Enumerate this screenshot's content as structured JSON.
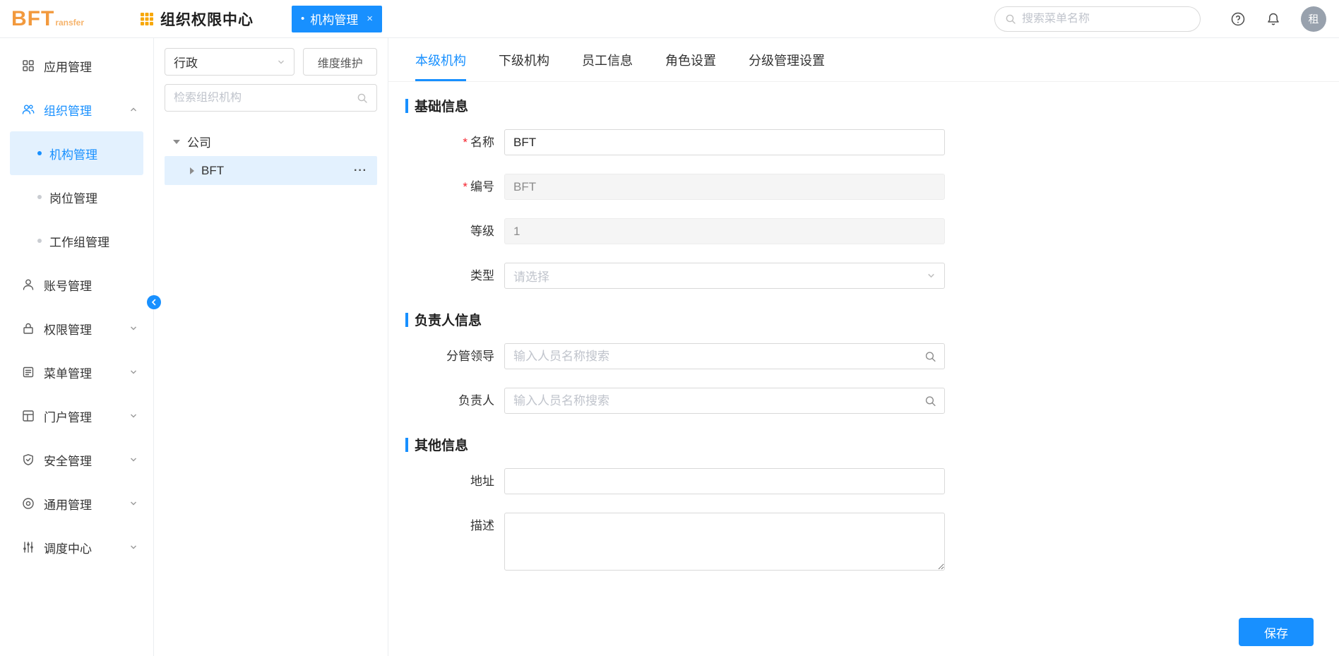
{
  "colors": {
    "primary": "#1890ff",
    "logo_orange": "#f2993d",
    "active_item_bg": "#e3f1fe",
    "required_red": "#f5222d"
  },
  "header": {
    "logo_main": "BFT",
    "logo_sub": "ransfer",
    "app_title": "组织权限中心",
    "tab": {
      "dot": "•",
      "label": "机构管理",
      "close": "×"
    },
    "search_placeholder": "搜索菜单名称",
    "avatar": "租"
  },
  "sidebar": {
    "items": [
      {
        "label": "应用管理",
        "icon": "grid-icon"
      },
      {
        "label": "组织管理",
        "icon": "team-icon",
        "expanded": true,
        "active": true
      },
      {
        "label": "账号管理",
        "icon": "user-icon"
      },
      {
        "label": "权限管理",
        "icon": "lock-icon",
        "collapsed": true
      },
      {
        "label": "菜单管理",
        "icon": "menu-icon",
        "collapsed": true
      },
      {
        "label": "门户管理",
        "icon": "portal-icon",
        "collapsed": true
      },
      {
        "label": "安全管理",
        "icon": "shield-icon",
        "collapsed": true
      },
      {
        "label": "通用管理",
        "icon": "target-icon",
        "collapsed": true
      },
      {
        "label": "调度中心",
        "icon": "sliders-icon",
        "collapsed": true
      }
    ],
    "org_children": [
      {
        "label": "机构管理",
        "active": true
      },
      {
        "label": "岗位管理"
      },
      {
        "label": "工作组管理"
      }
    ]
  },
  "tree_panel": {
    "dimension_value": "行政",
    "maintain_button": "维度维护",
    "search_placeholder": "检索组织机构",
    "nodes": [
      {
        "label": "公司",
        "expanded": true
      },
      {
        "label": "BFT",
        "selected": true,
        "more": "···"
      }
    ]
  },
  "content": {
    "tabs": [
      {
        "label": "本级机构",
        "active": true
      },
      {
        "label": "下级机构"
      },
      {
        "label": "员工信息"
      },
      {
        "label": "角色设置"
      },
      {
        "label": "分级管理设置"
      }
    ],
    "sections": {
      "basic": {
        "title": "基础信息",
        "fields": [
          {
            "label": "名称",
            "required": "*",
            "value": "BFT"
          },
          {
            "label": "编号",
            "required": "*",
            "value": "BFT",
            "disabled": true
          },
          {
            "label": "等级",
            "value": "1",
            "disabled": true
          },
          {
            "label": "类型",
            "placeholder": "请选择"
          }
        ]
      },
      "leader": {
        "title": "负责人信息",
        "fields": [
          {
            "label": "分管领导",
            "placeholder": "输入人员名称搜索"
          },
          {
            "label": "负责人",
            "placeholder": "输入人员名称搜索"
          }
        ]
      },
      "other": {
        "title": "其他信息",
        "fields": [
          {
            "label": "地址",
            "value": ""
          },
          {
            "label": "描述",
            "value": ""
          }
        ]
      }
    },
    "save_button": "保存"
  }
}
